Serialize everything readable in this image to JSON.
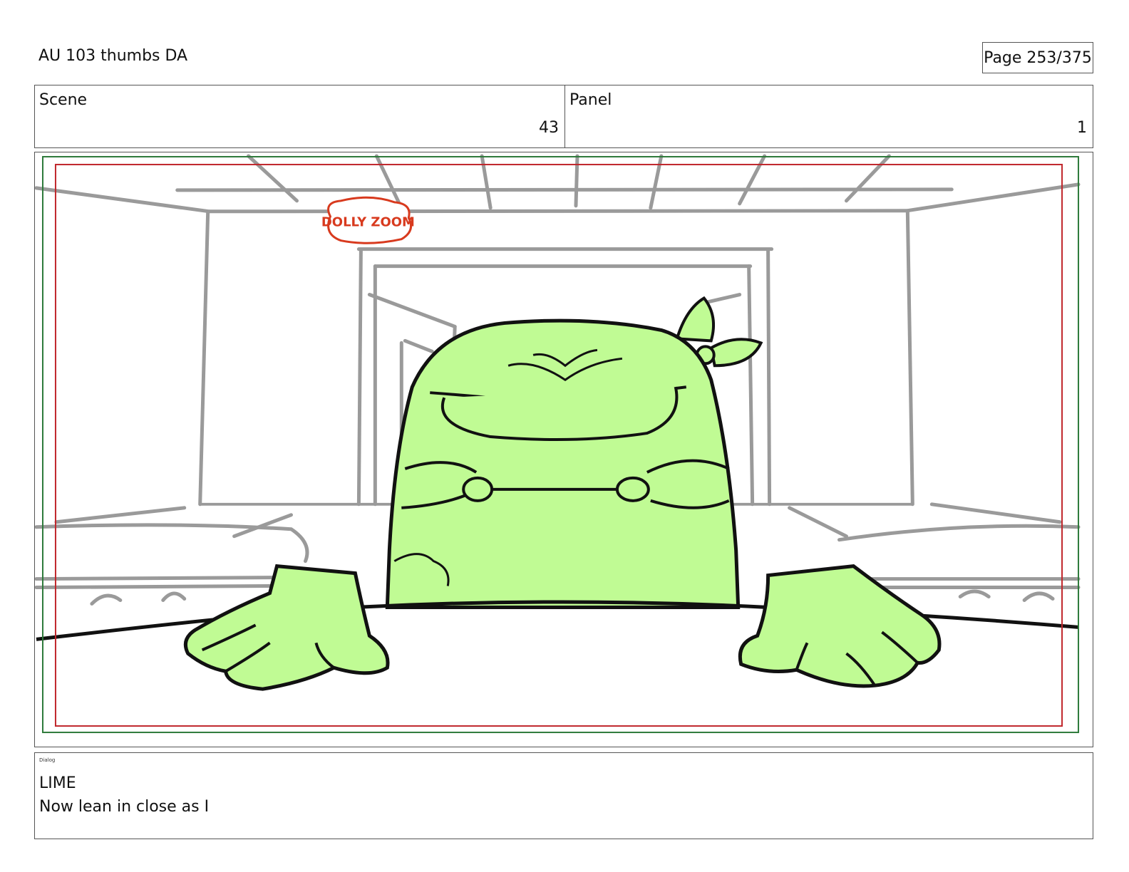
{
  "header": {
    "title": "AU 103 thumbs DA",
    "page": "Page 253/375"
  },
  "info": {
    "scene_label": "Scene",
    "scene_value": "43",
    "panel_label": "Panel",
    "panel_value": "1"
  },
  "panel": {
    "sketch_note": "DOLLY ZOOM",
    "colors": {
      "character_fill": "#c0fb94",
      "sketch_lines": "#9a9a9a",
      "safe_frame_red": "#c0262b",
      "action_frame_green": "#2d7a3a",
      "note_red": "#d83a1e"
    }
  },
  "dialog": {
    "label": "Dialog",
    "speaker": "LIME",
    "line": "Now lean in close as I"
  }
}
